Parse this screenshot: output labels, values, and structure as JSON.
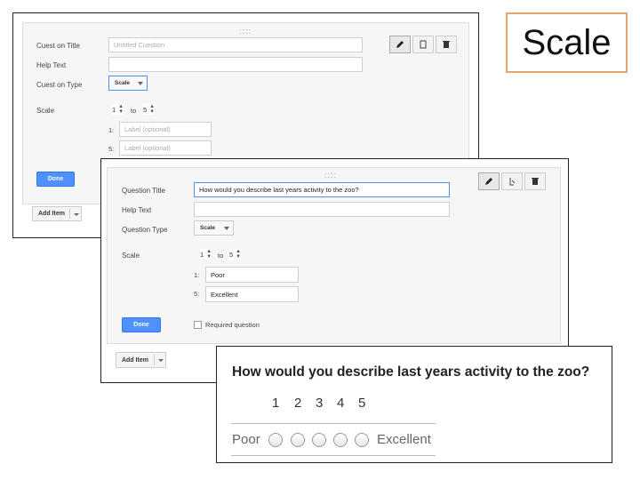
{
  "title": "Scale",
  "editor_back": {
    "labels": {
      "question_title": "Cuest on Title",
      "help_text": "Help Text",
      "question_type": "Cuest on Type",
      "scale": "Scale"
    },
    "title_placeholder": "Untitled Cuestion",
    "type_value": "Scale",
    "scale_from": "1",
    "scale_to_word": "to",
    "scale_to": "5",
    "low_label": {
      "index": "1:",
      "placeholder": "Label (optional)"
    },
    "high_label": {
      "index": "5:",
      "placeholder": "Label (optional)"
    },
    "done": "Done",
    "add_item": "Add Item",
    "grip": "::::",
    "tools": [
      "pencil-icon",
      "copy-icon",
      "trash-icon"
    ]
  },
  "editor_front": {
    "labels": {
      "question_title": "Question Title",
      "help_text": "Help Text",
      "question_type": "Question Type",
      "scale": "Scale"
    },
    "title_value": "How would you describe last years activity to the zoo?",
    "type_value": "Scale",
    "scale_from": "1",
    "scale_to_word": "to",
    "scale_to": "5",
    "low_label": {
      "index": "1:",
      "value": "Poor"
    },
    "high_label": {
      "index": "5:",
      "value": "Excellent"
    },
    "done": "Done",
    "required": "Required question",
    "add_item": "Add Item",
    "grip": "::::",
    "tools": [
      "pencil-icon",
      "copy-icon",
      "trash-icon"
    ]
  },
  "preview": {
    "question": "How would you describe last years activity to the zoo?",
    "numbers": [
      "1",
      "2",
      "3",
      "4",
      "5"
    ],
    "low": "Poor",
    "high": "Excellent"
  },
  "colors": {
    "accent": "#4d90fe",
    "title_border": "#e8a36b"
  }
}
